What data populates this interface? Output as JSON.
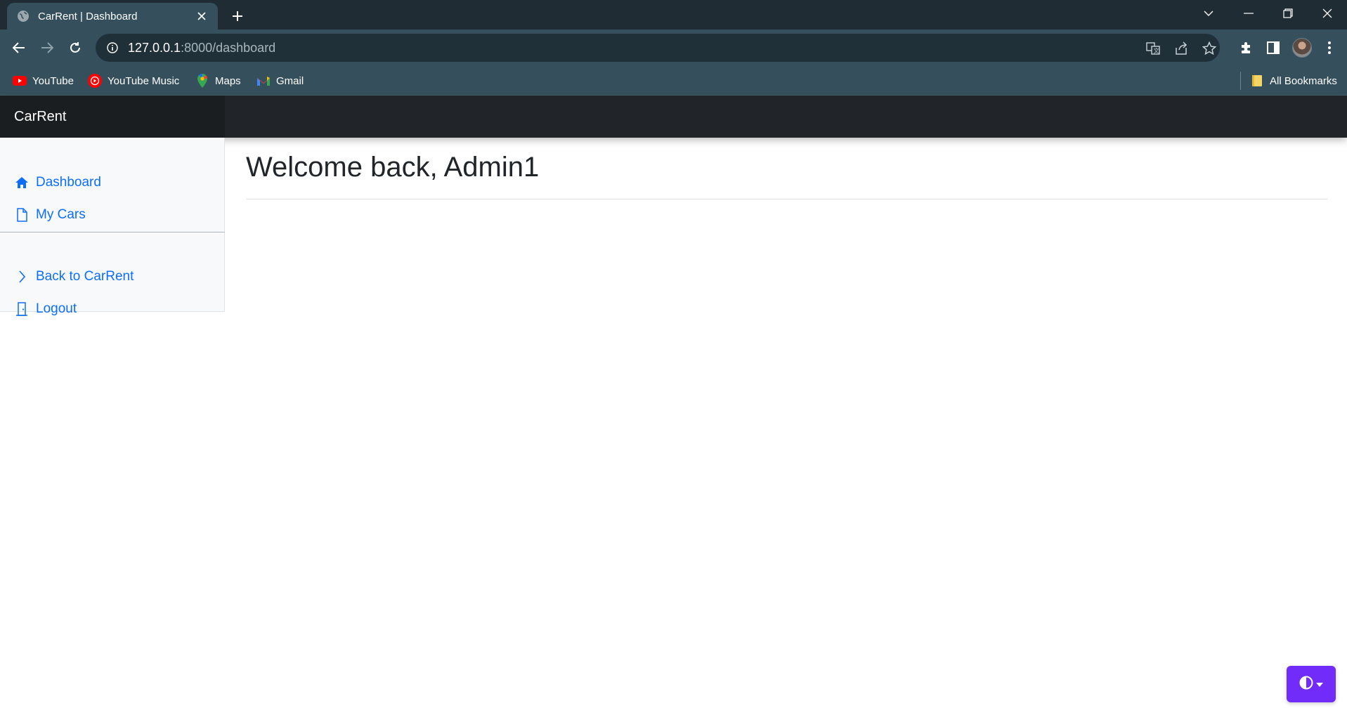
{
  "browser": {
    "tab": {
      "title": "CarRent | Dashboard",
      "favicon": "globe-icon"
    },
    "url": {
      "host": "127.0.0.1",
      "path": ":8000/dashboard"
    },
    "bookmarks": [
      {
        "label": "YouTube",
        "icon": "youtube-icon"
      },
      {
        "label": "YouTube Music",
        "icon": "youtube-music-icon"
      },
      {
        "label": "Maps",
        "icon": "maps-icon"
      },
      {
        "label": "Gmail",
        "icon": "gmail-icon"
      }
    ],
    "all_bookmarks": "All Bookmarks"
  },
  "app": {
    "brand": "CarRent",
    "sidebar": {
      "primary": [
        {
          "label": "Dashboard",
          "icon": "house-icon"
        },
        {
          "label": "My Cars",
          "icon": "file-icon"
        }
      ],
      "secondary": [
        {
          "label": "Back to CarRent",
          "icon": "chevron-right-icon"
        },
        {
          "label": "Logout",
          "icon": "door-icon"
        }
      ]
    },
    "main": {
      "title": "Welcome back, Admin1"
    },
    "theme_toggle": {
      "icon": "contrast-icon"
    }
  },
  "colors": {
    "link": "#0d6efd",
    "navbar": "#212529",
    "brand_bg": "#1b1e21",
    "theme_button": "#712cf9",
    "chrome_toolbar": "#35505c",
    "chrome_tabstrip": "#1f2c33"
  }
}
